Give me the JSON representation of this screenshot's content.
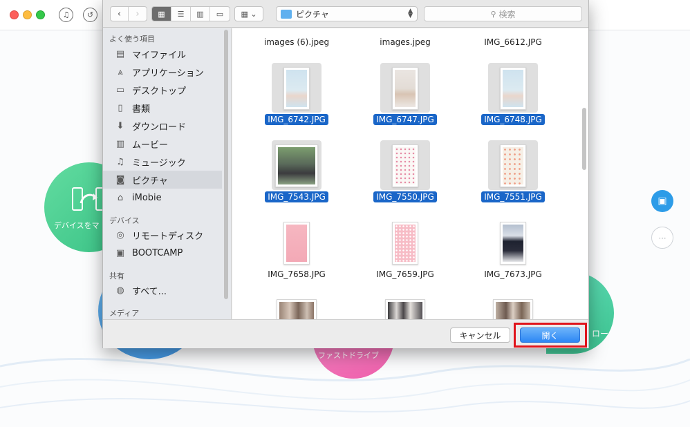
{
  "app": {
    "circle_green_label": "デバイスをマ",
    "circle_pink_label": "ファストドライブ",
    "circle_teal_label": "ロー"
  },
  "toolbar": {
    "path_popup": "ピクチャ",
    "search_placeholder": "検索"
  },
  "sidebar": {
    "sections": {
      "favorites": "よく使う項目",
      "devices": "デバイス",
      "shared": "共有",
      "media": "メディア"
    },
    "favorites": [
      {
        "label": "マイファイル",
        "icon": "all-my-files-icon"
      },
      {
        "label": "アプリケーション",
        "icon": "applications-icon"
      },
      {
        "label": "デスクトップ",
        "icon": "desktop-icon"
      },
      {
        "label": "書類",
        "icon": "documents-icon"
      },
      {
        "label": "ダウンロード",
        "icon": "downloads-icon"
      },
      {
        "label": "ムービー",
        "icon": "movies-icon"
      },
      {
        "label": "ミュージック",
        "icon": "music-icon"
      },
      {
        "label": "ピクチャ",
        "icon": "pictures-icon",
        "selected": true
      },
      {
        "label": "iMobie",
        "icon": "home-icon"
      }
    ],
    "devices": [
      {
        "label": "リモートディスク",
        "icon": "remote-disc-icon"
      },
      {
        "label": "BOOTCAMP",
        "icon": "disk-icon"
      }
    ],
    "shared": [
      {
        "label": "すべて...",
        "icon": "network-icon"
      }
    ]
  },
  "files": [
    {
      "name": "images (6).jpeg",
      "selected": false
    },
    {
      "name": "images.jpeg",
      "selected": false
    },
    {
      "name": "IMG_6612.JPG",
      "selected": false
    },
    {
      "name": "IMG_6742.JPG",
      "selected": true
    },
    {
      "name": "IMG_6747.JPG",
      "selected": true
    },
    {
      "name": "IMG_6748.JPG",
      "selected": true
    },
    {
      "name": "IMG_7543.JPG",
      "selected": true
    },
    {
      "name": "IMG_7550.JPG",
      "selected": true
    },
    {
      "name": "IMG_7551.JPG",
      "selected": true
    },
    {
      "name": "IMG_7658.JPG",
      "selected": false
    },
    {
      "name": "IMG_7659.JPG",
      "selected": false
    },
    {
      "name": "IMG_7673.JPG",
      "selected": false
    }
  ],
  "buttons": {
    "cancel": "キャンセル",
    "open": "開く"
  },
  "colors": {
    "selection": "#1a66c8",
    "highlight_frame": "#e0141b",
    "primary_button": "#2d87f4"
  }
}
